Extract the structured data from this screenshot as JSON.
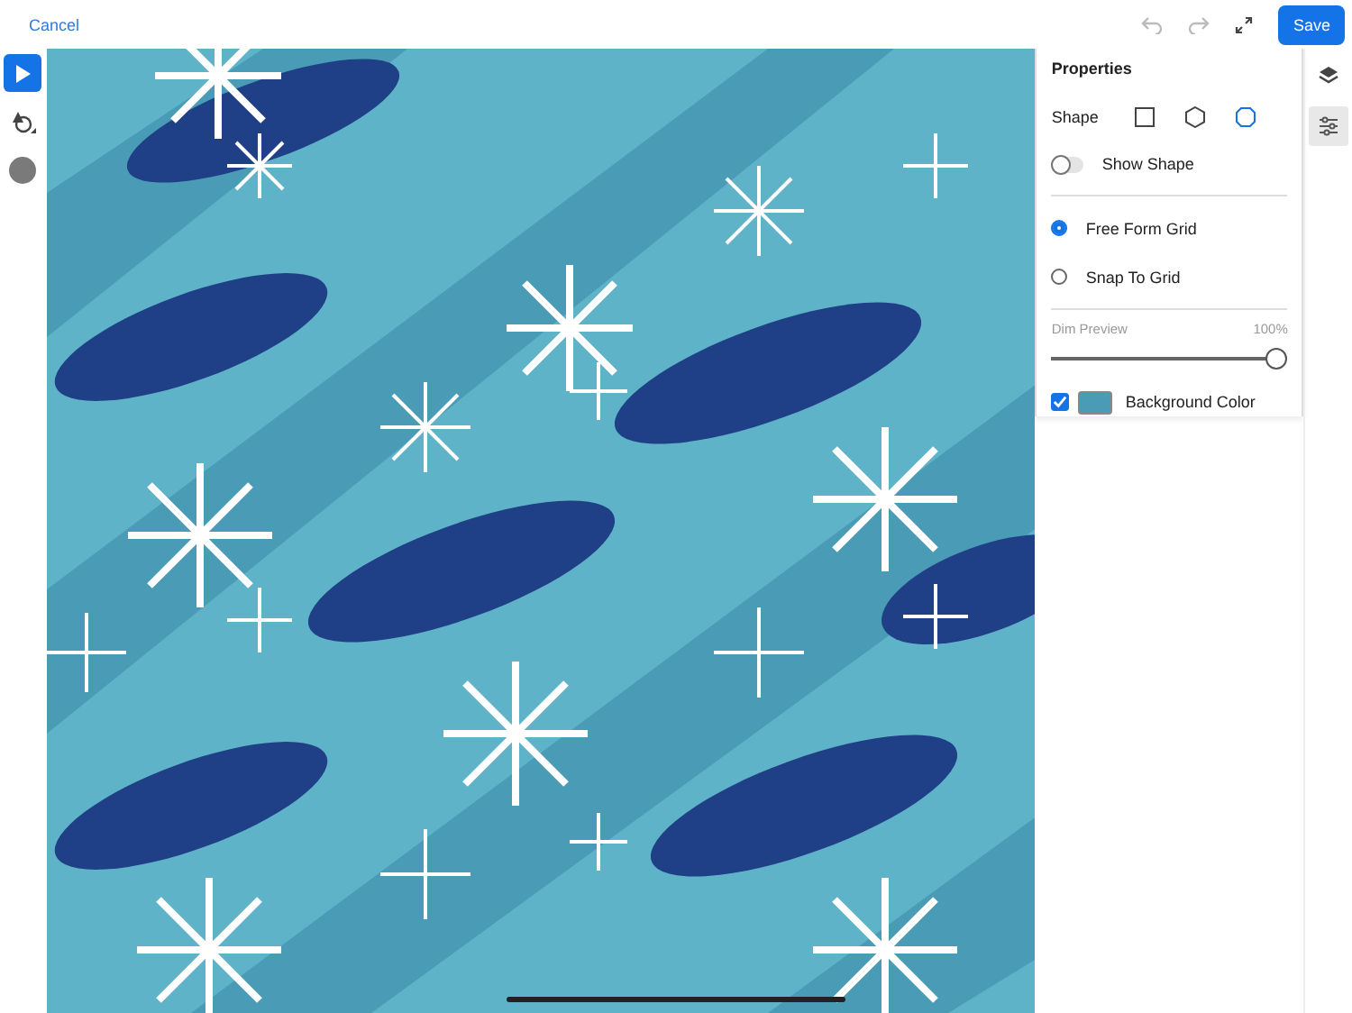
{
  "top_bar": {
    "cancel": "Cancel",
    "undo_disabled": true,
    "redo_disabled": true,
    "save": "Save"
  },
  "tools": [
    {
      "kind": "select",
      "selected": true
    },
    {
      "kind": "shape",
      "selected": false
    },
    {
      "kind": "color",
      "selected": false,
      "color": "#7a7a7a"
    }
  ],
  "properties": {
    "title": "Properties",
    "shape_label": "Shape",
    "shapes": [
      {
        "kind": "square",
        "selected": false
      },
      {
        "kind": "hexagon",
        "selected": false
      },
      {
        "kind": "octagon",
        "selected": true
      }
    ],
    "show_shape": {
      "label": "Show Shape",
      "on": false
    },
    "grid_options": [
      {
        "label": "Free Form Grid",
        "selected": true
      },
      {
        "label": "Snap To Grid",
        "selected": false
      }
    ],
    "dim_preview": {
      "label": "Dim Preview",
      "reading": "100%",
      "level": 1.0
    },
    "background": {
      "label": "Background Color",
      "checked": true,
      "color": "#4a9bb5"
    }
  },
  "side_tabs": [
    {
      "kind": "layers",
      "selected": false
    },
    {
      "kind": "adjust",
      "selected": true
    }
  ]
}
